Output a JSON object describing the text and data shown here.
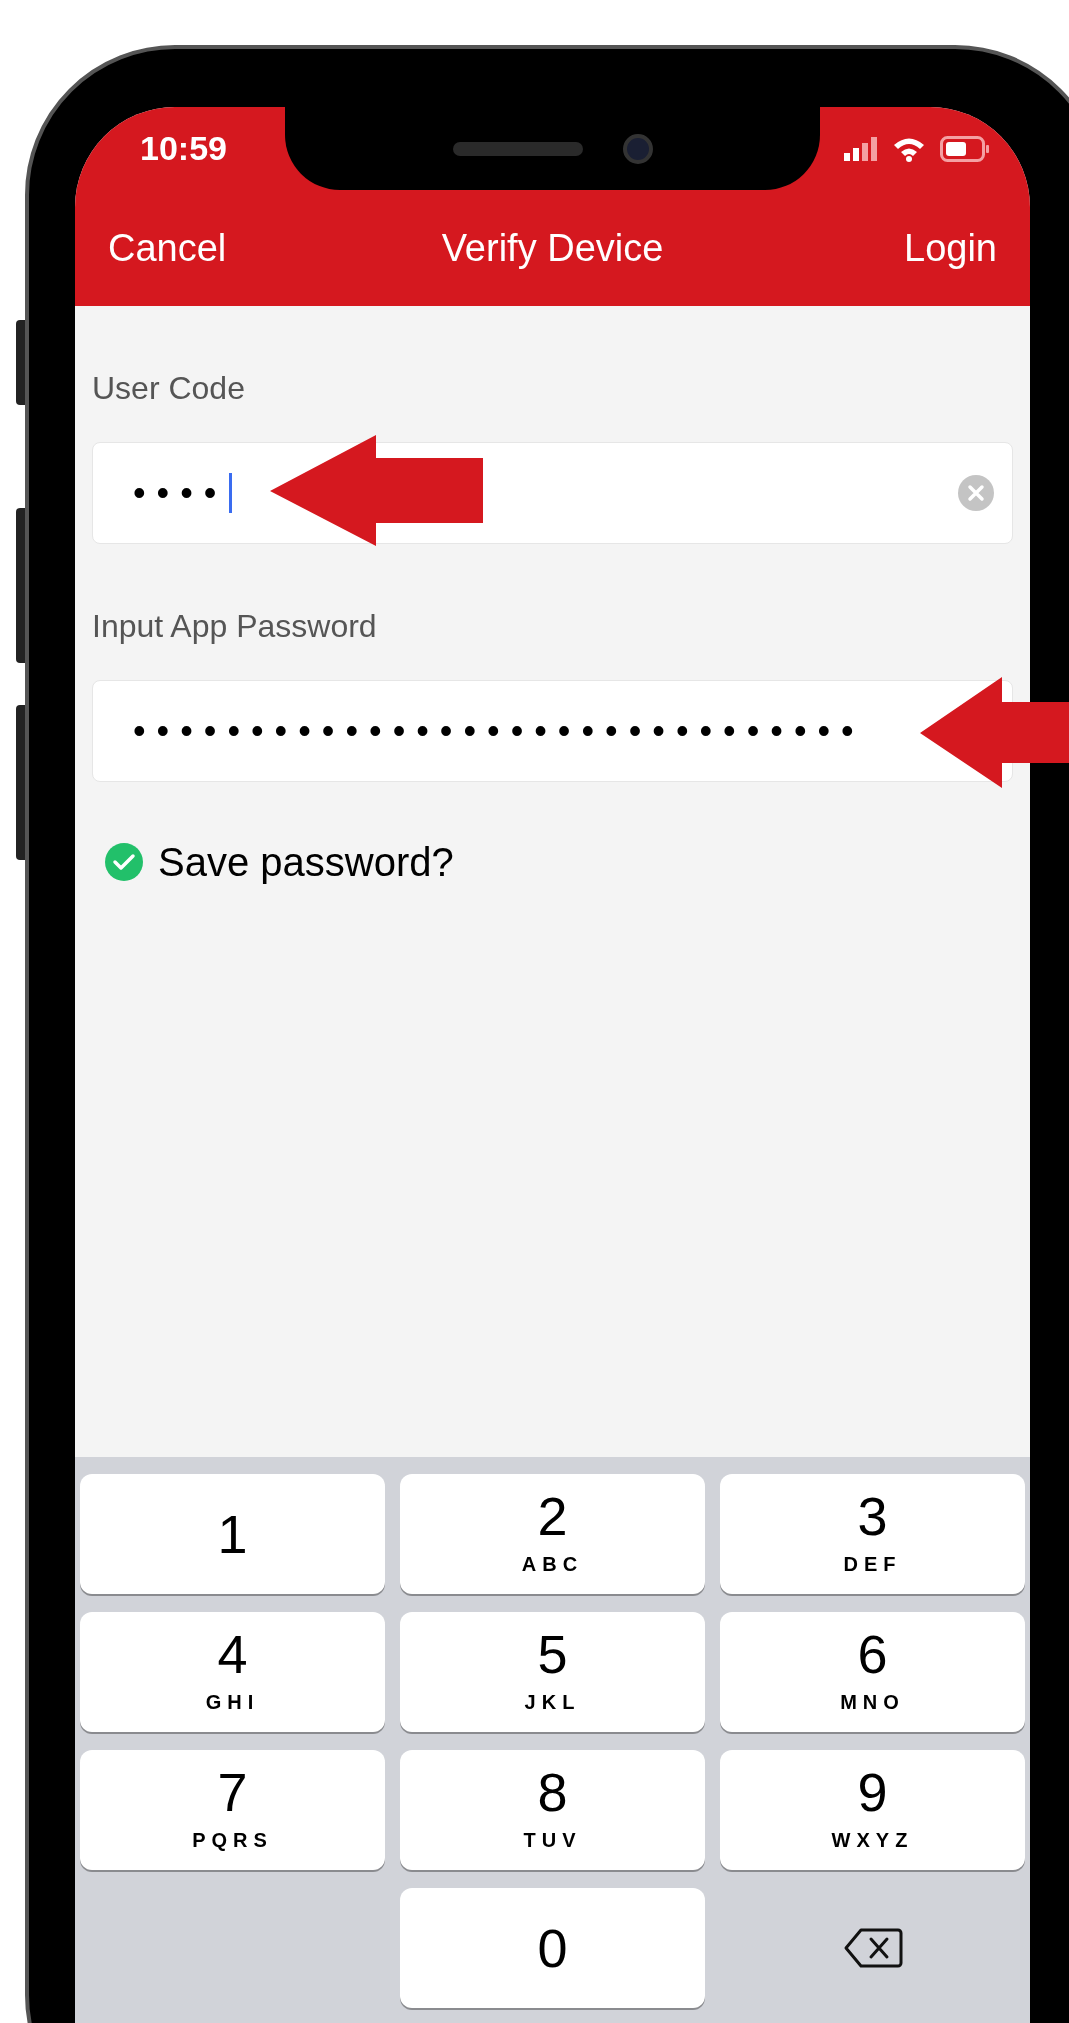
{
  "status_bar": {
    "time": "10:59"
  },
  "nav": {
    "cancel": "Cancel",
    "title": "Verify Device",
    "login": "Login"
  },
  "fields": [
    {
      "label": "User Code",
      "value": "••••",
      "focused": true,
      "clear_button": true
    },
    {
      "label": "Input App Password",
      "value": "•••••••••••••••••••••••••••••••",
      "focused": false,
      "clear_button": false
    }
  ],
  "save_password": {
    "label": "Save password?",
    "checked": true
  },
  "keypad": [
    {
      "kind": "digit",
      "digit": "1"
    },
    {
      "kind": "digit",
      "digit": "2",
      "letters": "ABC"
    },
    {
      "kind": "digit",
      "digit": "3",
      "letters": "DEF"
    },
    {
      "kind": "digit",
      "digit": "4",
      "letters": "GHI"
    },
    {
      "kind": "digit",
      "digit": "5",
      "letters": "JKL"
    },
    {
      "kind": "digit",
      "digit": "6",
      "letters": "MNO"
    },
    {
      "kind": "digit",
      "digit": "7",
      "letters": "PQRS"
    },
    {
      "kind": "digit",
      "digit": "8",
      "letters": "TUV"
    },
    {
      "kind": "digit",
      "digit": "9",
      "letters": "WXYZ"
    },
    {
      "kind": "blank"
    },
    {
      "kind": "digit",
      "digit": "0"
    },
    {
      "kind": "backspace"
    }
  ]
}
